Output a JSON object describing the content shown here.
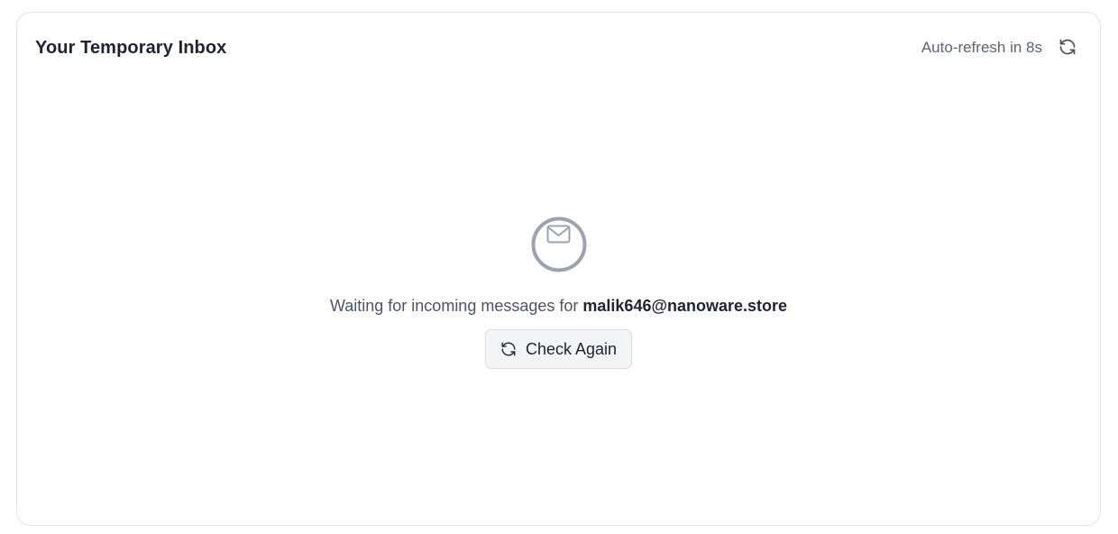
{
  "inbox": {
    "title": "Your Temporary Inbox",
    "auto_refresh_label": "Auto-refresh in 8s",
    "refresh_icon": "refresh-icon"
  },
  "empty_state": {
    "icon": "mail-icon",
    "message_prefix": "Waiting for incoming messages for",
    "email": "malik646@nanoware.store",
    "check_again_label": "Check Again",
    "check_again_icon": "refresh-icon"
  },
  "colors": {
    "border": "#e2e4e8",
    "title_text": "#1f2430",
    "muted_text": "#5d6472",
    "icon_gray": "#9ca3af",
    "button_bg": "#f3f4f6"
  }
}
